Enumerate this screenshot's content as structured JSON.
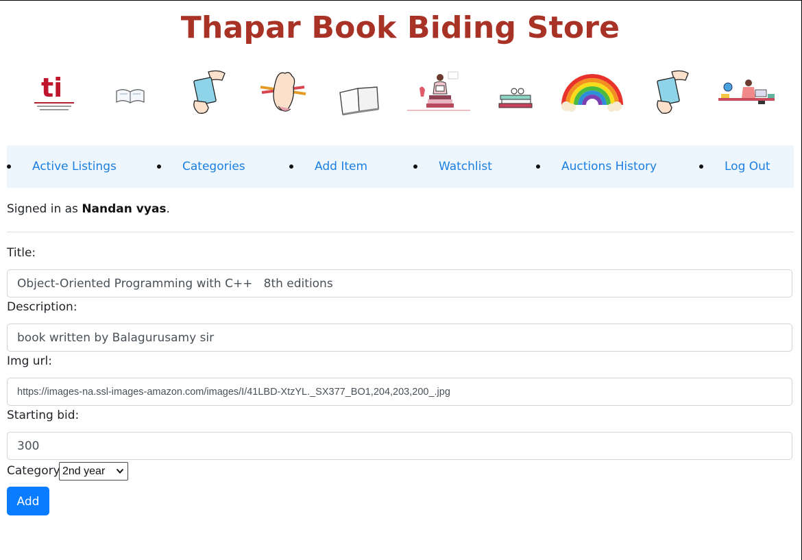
{
  "header": {
    "title": "Thapar Book Biding Store",
    "title_color": "#a93226",
    "banner_icons": [
      "thapar-logo-icon",
      "open-book-icon",
      "hand-holding-book-icon",
      "hand-holding-pencils-icon",
      "open-book-sketch-icon",
      "reading-person-icon",
      "book-stack-glasses-icon",
      "rainbow-icon",
      "hand-holding-book-icon",
      "student-desk-icon"
    ],
    "logo_letters": "ti"
  },
  "nav": {
    "background": "#eef6fd",
    "link_color": "#1a7fe0",
    "items": [
      "Active Listings",
      "Categories",
      "Add Item",
      "Watchlist",
      "Auctions History",
      "Log Out"
    ]
  },
  "user": {
    "signed_prefix": "Signed in as ",
    "name": "Nandan vyas",
    "signed_suffix": "."
  },
  "form": {
    "title_label": "Title:",
    "title_value": "Object-Oriented Programming with C++   8th editions",
    "description_label": "Description:",
    "description_value": "book written by Balagurusamy sir",
    "img_label": "Img url:",
    "img_value": "https://images-na.ssl-images-amazon.com/images/I/41LBD-XtzYL._SX377_BO1,204,203,200_.jpg",
    "bid_label": "Starting bid:",
    "bid_value": "300",
    "category_label": "Category:",
    "category_selected": "2nd year",
    "add_label": "Add",
    "button_color": "#0a7cff"
  }
}
